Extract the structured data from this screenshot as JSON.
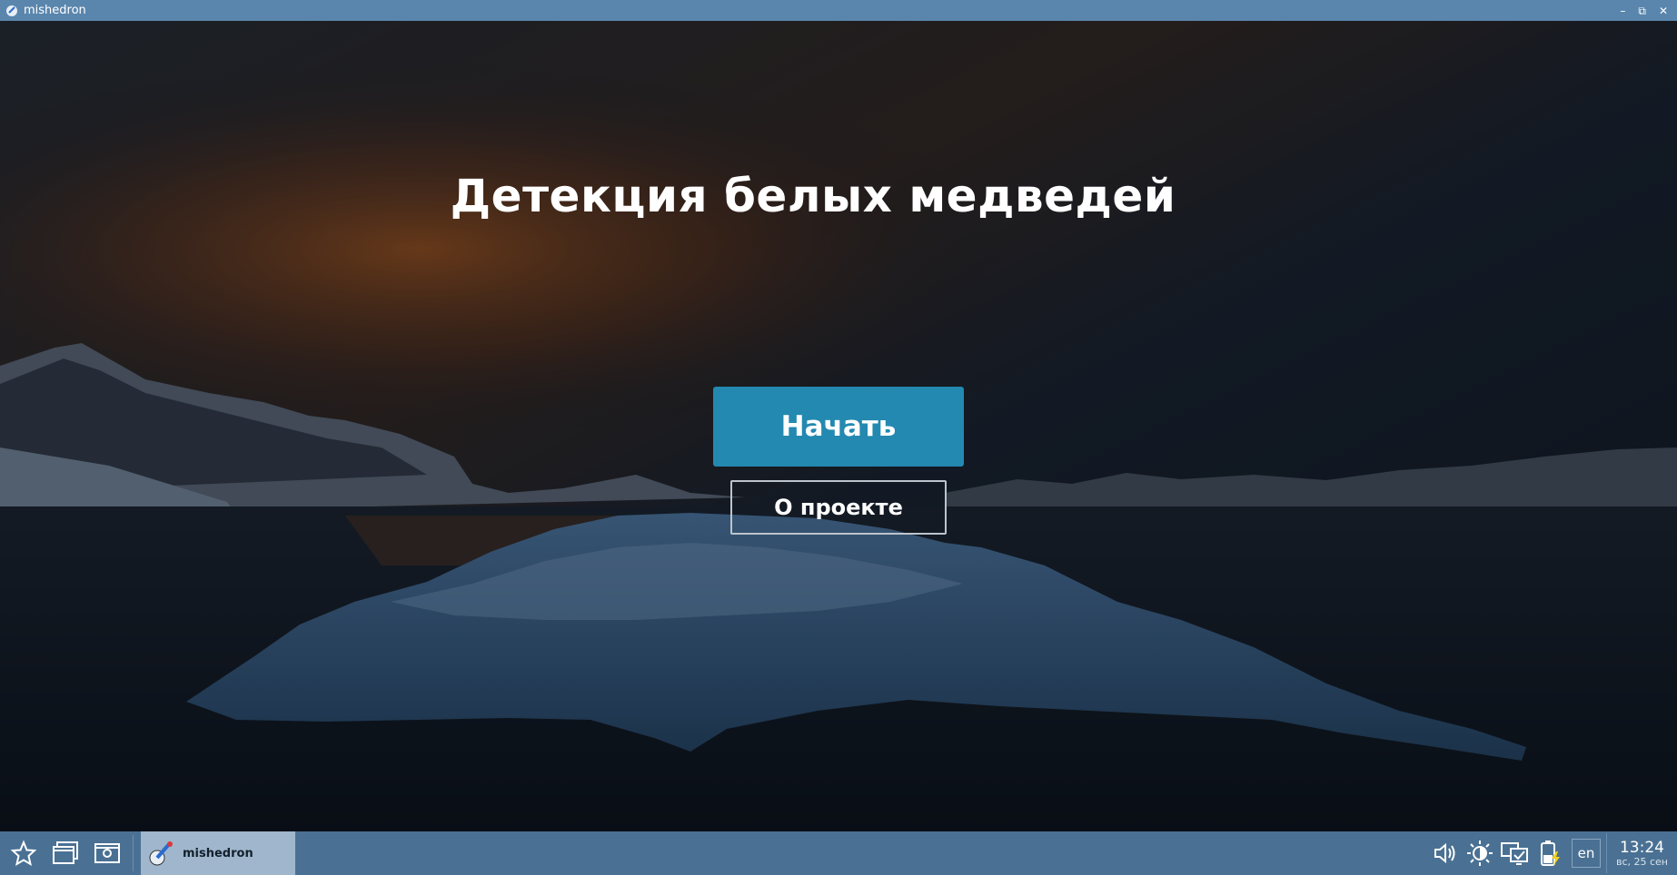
{
  "window": {
    "title": "mishedron",
    "controls": {
      "minimize": "–",
      "restore": "⧉",
      "close": "✕"
    }
  },
  "main": {
    "heading": "Детекция белых медведей",
    "start_button": "Начать",
    "about_button": "О проекте"
  },
  "taskbar": {
    "launcher_icon": "star-icon",
    "task_label": "mishedron",
    "language": "en",
    "time": "13:24",
    "date": "вс, 25 сен"
  },
  "colors": {
    "titlebar": "#5a86ad",
    "taskbar": "#4a7193",
    "primary_button": "#2389b0"
  }
}
